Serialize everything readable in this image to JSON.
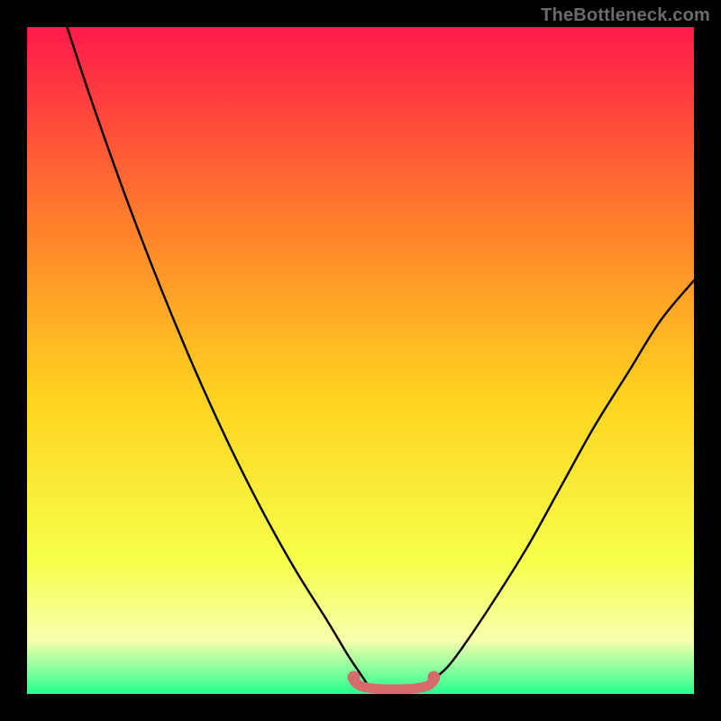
{
  "watermark": "TheBottleneck.com",
  "chart_data": {
    "type": "line",
    "title": "",
    "xlabel": "",
    "ylabel": "",
    "xlim": [
      0,
      100
    ],
    "ylim": [
      0,
      100
    ],
    "grid": false,
    "legend": false,
    "annotations": [],
    "colors": {
      "gradient_top": "#ff1a4b",
      "gradient_mid_upper": "#ff7a2c",
      "gradient_mid": "#ffd21f",
      "gradient_lower": "#f6ff4a",
      "gradient_band": "#f7ffad",
      "gradient_bottom": "#26ff8e",
      "curve": "#000000",
      "marker": "#d76a6a"
    },
    "series": [
      {
        "name": "left_branch",
        "color": "#000000",
        "x": [
          6,
          10,
          15,
          20,
          25,
          30,
          35,
          40,
          45,
          48,
          50,
          51
        ],
        "y": [
          100,
          88,
          74,
          61,
          49,
          38,
          28,
          19,
          11,
          6,
          3,
          1.5
        ]
      },
      {
        "name": "right_branch",
        "color": "#000000",
        "x": [
          60,
          63,
          66,
          70,
          75,
          80,
          85,
          90,
          95,
          100
        ],
        "y": [
          1.5,
          4,
          8,
          14,
          22,
          31,
          40,
          48,
          56,
          62
        ]
      },
      {
        "name": "bottom_connector",
        "color": "#d76a6a",
        "x": [
          49,
          50,
          52,
          54,
          56,
          58,
          60,
          61
        ],
        "y": [
          2.0,
          1.2,
          0.8,
          0.7,
          0.7,
          0.8,
          1.2,
          2.0
        ]
      }
    ],
    "markers": [
      {
        "x": 49,
        "y": 2.5,
        "color": "#d76a6a"
      },
      {
        "x": 61,
        "y": 2.5,
        "color": "#d76a6a"
      }
    ]
  }
}
